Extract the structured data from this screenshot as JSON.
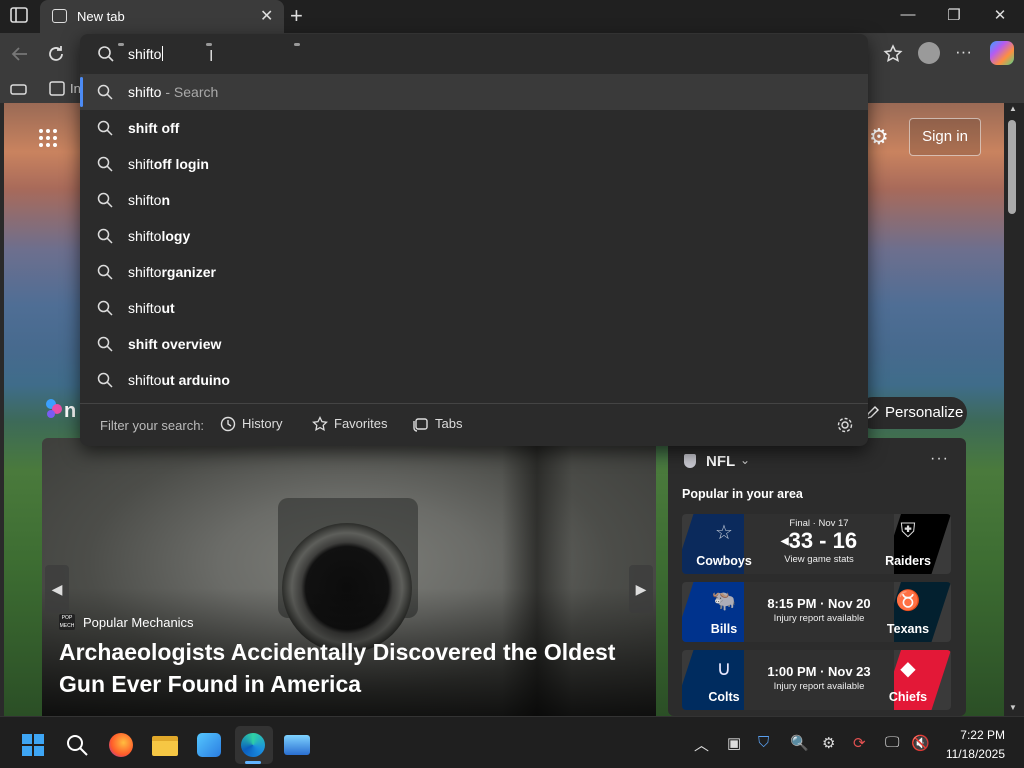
{
  "browser": {
    "tab_title": "New tab",
    "bookmark_partial": "In",
    "accent": "#4c8bf5"
  },
  "omnibox": {
    "typed": "shifto",
    "suggestions": [
      {
        "typed": "shifto",
        "rest": "",
        "hint": " - Search"
      },
      {
        "typed": "",
        "rest": "shift off",
        "hint": ""
      },
      {
        "typed": "shift",
        "rest": "off login",
        "hint": ""
      },
      {
        "typed": "shifto",
        "rest": "n",
        "hint": ""
      },
      {
        "typed": "shifto",
        "rest": "logy",
        "hint": ""
      },
      {
        "typed": "shifto",
        "rest": "rganizer",
        "hint": ""
      },
      {
        "typed": "shifto",
        "rest": "ut",
        "hint": ""
      },
      {
        "typed": "",
        "rest": "shift overview",
        "hint": ""
      },
      {
        "typed": "shifto",
        "rest": "ut arduino",
        "hint": ""
      }
    ],
    "filter": {
      "label": "Filter your search:",
      "history": "History",
      "favorites": "Favorites",
      "tabs": "Tabs"
    }
  },
  "page": {
    "sign_in": "Sign in",
    "personalize": "Personalize",
    "article": {
      "source": "Popular Mechanics",
      "headline": "Archaeologists Accidentally Discovered the Oldest Gun Ever Found in America"
    },
    "nfl": {
      "title": "NFL",
      "subtitle": "Popular in your area",
      "games": [
        {
          "home": "Cowboys",
          "away": "Raiders",
          "line1": "Final · Nov 17",
          "score": "33 - 16",
          "line2": "View game stats",
          "home_color": "#0b2a5c",
          "away_color": "#000000"
        },
        {
          "home": "Bills",
          "away": "Texans",
          "line1": "8:15 PM · Nov 20",
          "score": "",
          "line2": "Injury report available",
          "home_color": "#00338d",
          "away_color": "#03202f"
        },
        {
          "home": "Colts",
          "away": "Chiefs",
          "line1": "1:00 PM · Nov 23",
          "score": "",
          "line2": "Injury report available",
          "home_color": "#002c5f",
          "away_color": "#e31837"
        }
      ]
    }
  },
  "taskbar": {
    "time": "7:22 PM",
    "date": "11/18/2025"
  }
}
